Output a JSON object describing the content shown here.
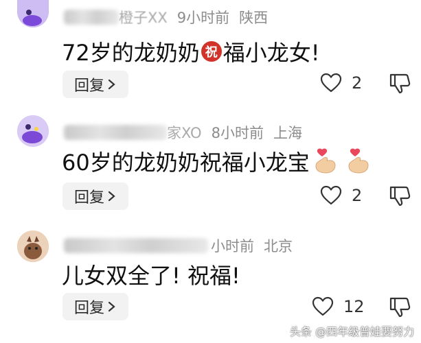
{
  "comments": [
    {
      "location_time": "9小时前",
      "location": "陕西",
      "name_visible": "橙子XX",
      "text_before": "72岁的龙奶奶",
      "badge": "祝",
      "text_after": "福小龙女!",
      "reply_label": "回复",
      "likes": "2"
    },
    {
      "location_time": "8小时前",
      "location": "上海",
      "name_visible": "家XO",
      "text": "60岁的龙奶奶祝福小龙宝",
      "reply_label": "回复",
      "likes": "2"
    },
    {
      "location_time": "小时前",
      "location": "北京",
      "text": "儿女双全了! 祝福!",
      "reply_label": "回复",
      "likes": "12"
    }
  ],
  "watermark": "头条 @四年级普娃要努力",
  "icons": {
    "chevron": "chevron-right-icon",
    "like": "heart-outline-icon",
    "dislike": "thumbs-down-icon",
    "emoji": "finger-heart-emoji"
  },
  "colors": {
    "badge": "#d1332b",
    "meta": "#8c8c8c",
    "reply_bg": "#f2f2f2"
  }
}
